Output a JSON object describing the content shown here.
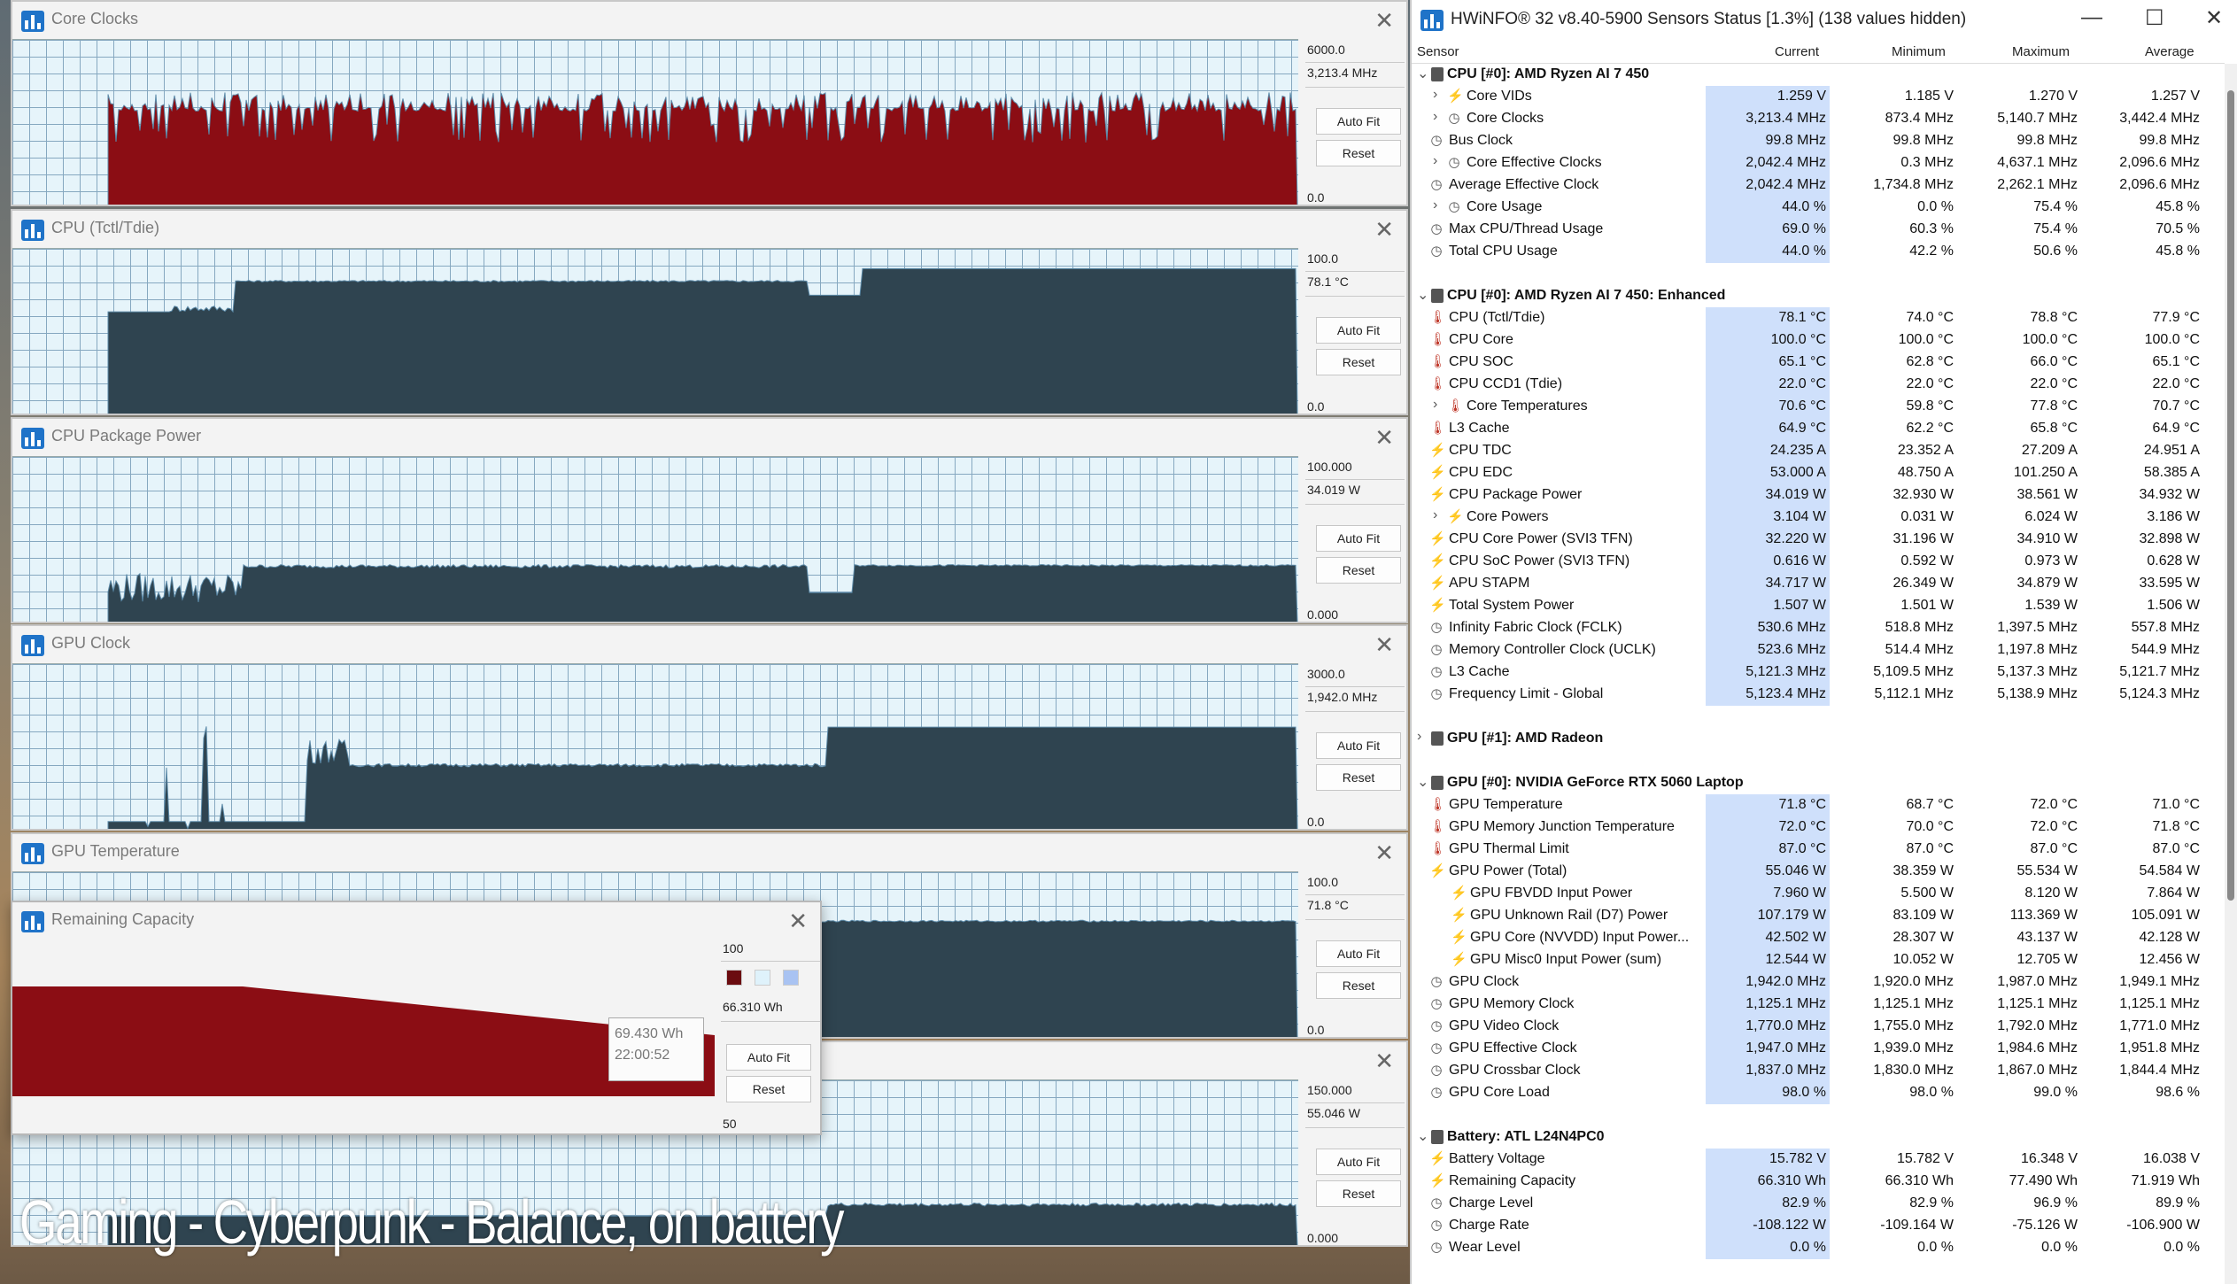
{
  "graph_windows": [
    {
      "title": "Core Clocks",
      "max": "6000.0",
      "current": "3,213.4 MHz",
      "min": "0.0",
      "autofit": "Auto Fit",
      "reset": "Reset",
      "color": "#8b0d14"
    },
    {
      "title": "CPU (Tctl/Tdie)",
      "max": "100.0",
      "current": "78.1 °C",
      "min": "0.0",
      "autofit": "Auto Fit",
      "reset": "Reset",
      "color": "#2f4450"
    },
    {
      "title": "CPU Package Power",
      "max": "100.000",
      "current": "34.019 W",
      "min": "0.000",
      "autofit": "Auto Fit",
      "reset": "Reset",
      "color": "#2f4450"
    },
    {
      "title": "GPU Clock",
      "max": "3000.0",
      "current": "1,942.0 MHz",
      "min": "0.0",
      "autofit": "Auto Fit",
      "reset": "Reset",
      "color": "#2f4450"
    },
    {
      "title": "GPU Temperature",
      "max": "100.0",
      "current": "71.8 °C",
      "min": "0.0",
      "autofit": "Auto Fit",
      "reset": "Reset",
      "color": "#2f4450"
    },
    {
      "title": "",
      "max": "150.000",
      "current": "55.046 W",
      "min": "0.000",
      "autofit": "Auto Fit",
      "reset": "Reset",
      "color": "#2f4450"
    }
  ],
  "remaining_capacity": {
    "title": "Remaining Capacity",
    "max": "100",
    "current": "66.310 Wh",
    "min": "50",
    "autofit": "Auto Fit",
    "reset": "Reset",
    "tooltip_value": "69.430 Wh",
    "tooltip_time": "22:00:52",
    "color": "#8b0d14",
    "swatch_colors": [
      "#6b0c10",
      "#dff2fb",
      "#a9c3f2"
    ]
  },
  "caption": "Gaming - Cyberpunk - Balance, on battery",
  "hwinfo": {
    "title": "HWiNFO® 32 v8.40-5900 Sensors Status [1.3%] (138 values hidden)",
    "window_controls": {
      "minimize": "—",
      "maximize": "☐",
      "close": "✕"
    },
    "columns": {
      "sensor": "Sensor",
      "current": "Current",
      "minimum": "Minimum",
      "maximum": "Maximum",
      "average": "Average"
    },
    "rows": [
      {
        "t": "g",
        "name": "CPU [#0]: AMD Ryzen AI 7 450"
      },
      {
        "t": "s",
        "icon": "bolt",
        "lvl": 2,
        "name": "Core VIDs",
        "cur": "1.259 V",
        "min": "1.185 V",
        "max": "1.270 V",
        "avg": "1.257 V"
      },
      {
        "t": "s",
        "icon": "clock",
        "lvl": 2,
        "name": "Core Clocks",
        "cur": "3,213.4 MHz",
        "min": "873.4 MHz",
        "max": "5,140.7 MHz",
        "avg": "3,442.4 MHz"
      },
      {
        "t": "s",
        "icon": "clock",
        "lvl": 1,
        "name": "Bus Clock",
        "cur": "99.8 MHz",
        "min": "99.8 MHz",
        "max": "99.8 MHz",
        "avg": "99.8 MHz"
      },
      {
        "t": "s",
        "icon": "clock",
        "lvl": 2,
        "name": "Core Effective Clocks",
        "cur": "2,042.4 MHz",
        "min": "0.3 MHz",
        "max": "4,637.1 MHz",
        "avg": "2,096.6 MHz"
      },
      {
        "t": "s",
        "icon": "clock",
        "lvl": 1,
        "name": "Average Effective Clock",
        "cur": "2,042.4 MHz",
        "min": "1,734.8 MHz",
        "max": "2,262.1 MHz",
        "avg": "2,096.6 MHz"
      },
      {
        "t": "s",
        "icon": "clock",
        "lvl": 2,
        "name": "Core Usage",
        "cur": "44.0 %",
        "min": "0.0 %",
        "max": "75.4 %",
        "avg": "45.8 %"
      },
      {
        "t": "s",
        "icon": "clock",
        "lvl": 1,
        "name": "Max CPU/Thread Usage",
        "cur": "69.0 %",
        "min": "60.3 %",
        "max": "75.4 %",
        "avg": "70.5 %"
      },
      {
        "t": "s",
        "icon": "clock",
        "lvl": 1,
        "name": "Total CPU Usage",
        "cur": "44.0 %",
        "min": "42.2 %",
        "max": "50.6 %",
        "avg": "45.8 %"
      },
      {
        "t": "e"
      },
      {
        "t": "g",
        "name": "CPU [#0]: AMD Ryzen AI 7 450: Enhanced"
      },
      {
        "t": "s",
        "icon": "temp",
        "lvl": 1,
        "name": "CPU (Tctl/Tdie)",
        "cur": "78.1 °C",
        "min": "74.0 °C",
        "max": "78.8 °C",
        "avg": "77.9 °C"
      },
      {
        "t": "s",
        "icon": "temp",
        "lvl": 1,
        "name": "CPU Core",
        "cur": "100.0 °C",
        "min": "100.0 °C",
        "max": "100.0 °C",
        "avg": "100.0 °C"
      },
      {
        "t": "s",
        "icon": "temp",
        "lvl": 1,
        "name": "CPU SOC",
        "cur": "65.1 °C",
        "min": "62.8 °C",
        "max": "66.0 °C",
        "avg": "65.1 °C"
      },
      {
        "t": "s",
        "icon": "temp",
        "lvl": 1,
        "name": "CPU CCD1 (Tdie)",
        "cur": "22.0 °C",
        "min": "22.0 °C",
        "max": "22.0 °C",
        "avg": "22.0 °C"
      },
      {
        "t": "s",
        "icon": "temp",
        "lvl": 2,
        "name": "Core Temperatures",
        "cur": "70.6 °C",
        "min": "59.8 °C",
        "max": "77.8 °C",
        "avg": "70.7 °C"
      },
      {
        "t": "s",
        "icon": "temp",
        "lvl": 1,
        "name": "L3 Cache",
        "cur": "64.9 °C",
        "min": "62.2 °C",
        "max": "65.8 °C",
        "avg": "64.9 °C"
      },
      {
        "t": "s",
        "icon": "bolt",
        "lvl": 1,
        "name": "CPU TDC",
        "cur": "24.235 A",
        "min": "23.352 A",
        "max": "27.209 A",
        "avg": "24.951 A"
      },
      {
        "t": "s",
        "icon": "bolt",
        "lvl": 1,
        "name": "CPU EDC",
        "cur": "53.000 A",
        "min": "48.750 A",
        "max": "101.250 A",
        "avg": "58.385 A"
      },
      {
        "t": "s",
        "icon": "bolt",
        "lvl": 1,
        "name": "CPU Package Power",
        "cur": "34.019 W",
        "min": "32.930 W",
        "max": "38.561 W",
        "avg": "34.932 W"
      },
      {
        "t": "s",
        "icon": "bolt",
        "lvl": 2,
        "name": "Core Powers",
        "cur": "3.104 W",
        "min": "0.031 W",
        "max": "6.024 W",
        "avg": "3.186 W"
      },
      {
        "t": "s",
        "icon": "bolt",
        "lvl": 1,
        "name": "CPU Core Power (SVI3 TFN)",
        "cur": "32.220 W",
        "min": "31.196 W",
        "max": "34.910 W",
        "avg": "32.898 W"
      },
      {
        "t": "s",
        "icon": "bolt",
        "lvl": 1,
        "name": "CPU SoC Power (SVI3 TFN)",
        "cur": "0.616 W",
        "min": "0.592 W",
        "max": "0.973 W",
        "avg": "0.628 W"
      },
      {
        "t": "s",
        "icon": "bolt",
        "lvl": 1,
        "name": "APU STAPM",
        "cur": "34.717 W",
        "min": "26.349 W",
        "max": "34.879 W",
        "avg": "33.595 W"
      },
      {
        "t": "s",
        "icon": "bolt",
        "lvl": 1,
        "name": "Total System Power",
        "cur": "1.507 W",
        "min": "1.501 W",
        "max": "1.539 W",
        "avg": "1.506 W"
      },
      {
        "t": "s",
        "icon": "clock",
        "lvl": 1,
        "name": "Infinity Fabric Clock (FCLK)",
        "cur": "530.6 MHz",
        "min": "518.8 MHz",
        "max": "1,397.5 MHz",
        "avg": "557.8 MHz"
      },
      {
        "t": "s",
        "icon": "clock",
        "lvl": 1,
        "name": "Memory Controller Clock (UCLK)",
        "cur": "523.6 MHz",
        "min": "514.4 MHz",
        "max": "1,197.8 MHz",
        "avg": "544.9 MHz"
      },
      {
        "t": "s",
        "icon": "clock",
        "lvl": 1,
        "name": "L3 Cache",
        "cur": "5,121.3 MHz",
        "min": "5,109.5 MHz",
        "max": "5,137.3 MHz",
        "avg": "5,121.7 MHz"
      },
      {
        "t": "s",
        "icon": "clock",
        "lvl": 1,
        "name": "Frequency Limit - Global",
        "cur": "5,123.4 MHz",
        "min": "5,112.1 MHz",
        "max": "5,138.9 MHz",
        "avg": "5,124.3 MHz"
      },
      {
        "t": "e"
      },
      {
        "t": "g",
        "collapsed": true,
        "name": "GPU [#1]: AMD Radeon"
      },
      {
        "t": "e"
      },
      {
        "t": "g",
        "name": "GPU [#0]: NVIDIA GeForce RTX 5060 Laptop"
      },
      {
        "t": "s",
        "icon": "temp",
        "lvl": 1,
        "name": "GPU Temperature",
        "cur": "71.8 °C",
        "min": "68.7 °C",
        "max": "72.0 °C",
        "avg": "71.0 °C"
      },
      {
        "t": "s",
        "icon": "temp",
        "lvl": 1,
        "name": "GPU Memory Junction Temperature",
        "cur": "72.0 °C",
        "min": "70.0 °C",
        "max": "72.0 °C",
        "avg": "71.8 °C"
      },
      {
        "t": "s",
        "icon": "temp",
        "lvl": 1,
        "name": "GPU Thermal Limit",
        "cur": "87.0 °C",
        "min": "87.0 °C",
        "max": "87.0 °C",
        "avg": "87.0 °C"
      },
      {
        "t": "s",
        "icon": "bolt",
        "lvl": 1,
        "name": "GPU Power (Total)",
        "cur": "55.046 W",
        "min": "38.359 W",
        "max": "55.534 W",
        "avg": "54.584 W"
      },
      {
        "t": "s",
        "icon": "bolt",
        "lvl": 3,
        "name": "GPU FBVDD Input Power",
        "cur": "7.960 W",
        "min": "5.500 W",
        "max": "8.120 W",
        "avg": "7.864 W"
      },
      {
        "t": "s",
        "icon": "bolt",
        "lvl": 3,
        "name": "GPU Unknown Rail (D7) Power",
        "cur": "107.179 W",
        "min": "83.109 W",
        "max": "113.369 W",
        "avg": "105.091 W"
      },
      {
        "t": "s",
        "icon": "bolt",
        "lvl": 3,
        "name": "GPU Core (NVVDD) Input Power...",
        "cur": "42.502 W",
        "min": "28.307 W",
        "max": "43.137 W",
        "avg": "42.128 W"
      },
      {
        "t": "s",
        "icon": "bolt",
        "lvl": 3,
        "name": "GPU Misc0 Input Power (sum)",
        "cur": "12.544 W",
        "min": "10.052 W",
        "max": "12.705 W",
        "avg": "12.456 W"
      },
      {
        "t": "s",
        "icon": "clock",
        "lvl": 1,
        "name": "GPU Clock",
        "cur": "1,942.0 MHz",
        "min": "1,920.0 MHz",
        "max": "1,987.0 MHz",
        "avg": "1,949.1 MHz"
      },
      {
        "t": "s",
        "icon": "clock",
        "lvl": 1,
        "name": "GPU Memory Clock",
        "cur": "1,125.1 MHz",
        "min": "1,125.1 MHz",
        "max": "1,125.1 MHz",
        "avg": "1,125.1 MHz"
      },
      {
        "t": "s",
        "icon": "clock",
        "lvl": 1,
        "name": "GPU Video Clock",
        "cur": "1,770.0 MHz",
        "min": "1,755.0 MHz",
        "max": "1,792.0 MHz",
        "avg": "1,771.0 MHz"
      },
      {
        "t": "s",
        "icon": "clock",
        "lvl": 1,
        "name": "GPU Effective Clock",
        "cur": "1,947.0 MHz",
        "min": "1,939.0 MHz",
        "max": "1,984.6 MHz",
        "avg": "1,951.8 MHz"
      },
      {
        "t": "s",
        "icon": "clock",
        "lvl": 1,
        "name": "GPU Crossbar Clock",
        "cur": "1,837.0 MHz",
        "min": "1,830.0 MHz",
        "max": "1,867.0 MHz",
        "avg": "1,844.4 MHz"
      },
      {
        "t": "s",
        "icon": "clock",
        "lvl": 1,
        "name": "GPU Core Load",
        "cur": "98.0 %",
        "min": "98.0 %",
        "max": "99.0 %",
        "avg": "98.6 %"
      },
      {
        "t": "e"
      },
      {
        "t": "g",
        "name": "Battery: ATL L24N4PC0"
      },
      {
        "t": "s",
        "icon": "bolt",
        "lvl": 1,
        "name": "Battery Voltage",
        "cur": "15.782 V",
        "min": "15.782 V",
        "max": "16.348 V",
        "avg": "16.038 V"
      },
      {
        "t": "s",
        "icon": "bolt",
        "lvl": 1,
        "name": "Remaining Capacity",
        "cur": "66.310 Wh",
        "min": "66.310 Wh",
        "max": "77.490 Wh",
        "avg": "71.919 Wh"
      },
      {
        "t": "s",
        "icon": "clock",
        "lvl": 1,
        "name": "Charge Level",
        "cur": "82.9 %",
        "min": "82.9 %",
        "max": "96.9 %",
        "avg": "89.9 %"
      },
      {
        "t": "s",
        "icon": "clock",
        "lvl": 1,
        "name": "Charge Rate",
        "cur": "-108.122 W",
        "min": "-109.164 W",
        "max": "-75.126 W",
        "avg": "-106.900 W"
      },
      {
        "t": "s",
        "icon": "clock",
        "lvl": 1,
        "name": "Wear Level",
        "cur": "0.0 %",
        "min": "0.0 %",
        "max": "0.0 %",
        "avg": "0.0 %"
      }
    ]
  }
}
